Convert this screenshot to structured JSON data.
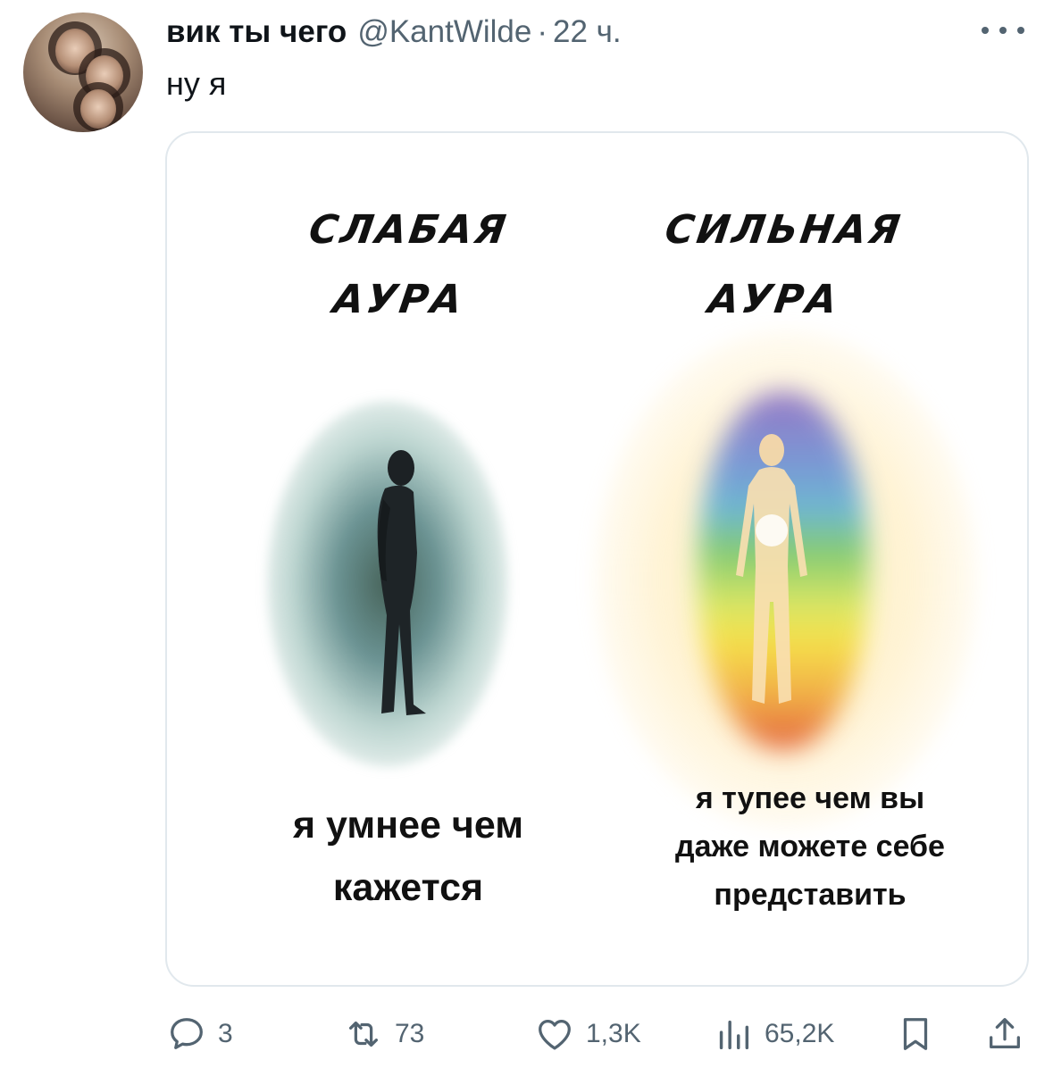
{
  "tweet": {
    "author_name": "вик ты чего",
    "author_handle": "@KantWilde",
    "separator": "·",
    "time": "22 ч.",
    "text": "ну я"
  },
  "meme": {
    "left_heading_line1": "СЛАБАЯ",
    "left_heading_line2": "АУРА",
    "right_heading_line1": "СИЛЬНАЯ",
    "right_heading_line2": "АУРА",
    "left_caption_line1": "я умнее чем",
    "left_caption_line2": "кажется",
    "right_caption_line1": "я тупее чем вы",
    "right_caption_line2": "даже можете себе",
    "right_caption_line3": "представить"
  },
  "actions": {
    "replies": "3",
    "retweets": "73",
    "likes": "1,3K",
    "views": "65,2K"
  },
  "icons": {
    "reply": "reply-icon",
    "retweet": "retweet-icon",
    "like": "heart-icon",
    "views": "views-icon",
    "bookmark": "bookmark-icon",
    "share": "share-icon",
    "more": "more-icon"
  },
  "colors": {
    "text": "#0f1419",
    "secondary": "#536471",
    "border": "#e1e8ed"
  }
}
